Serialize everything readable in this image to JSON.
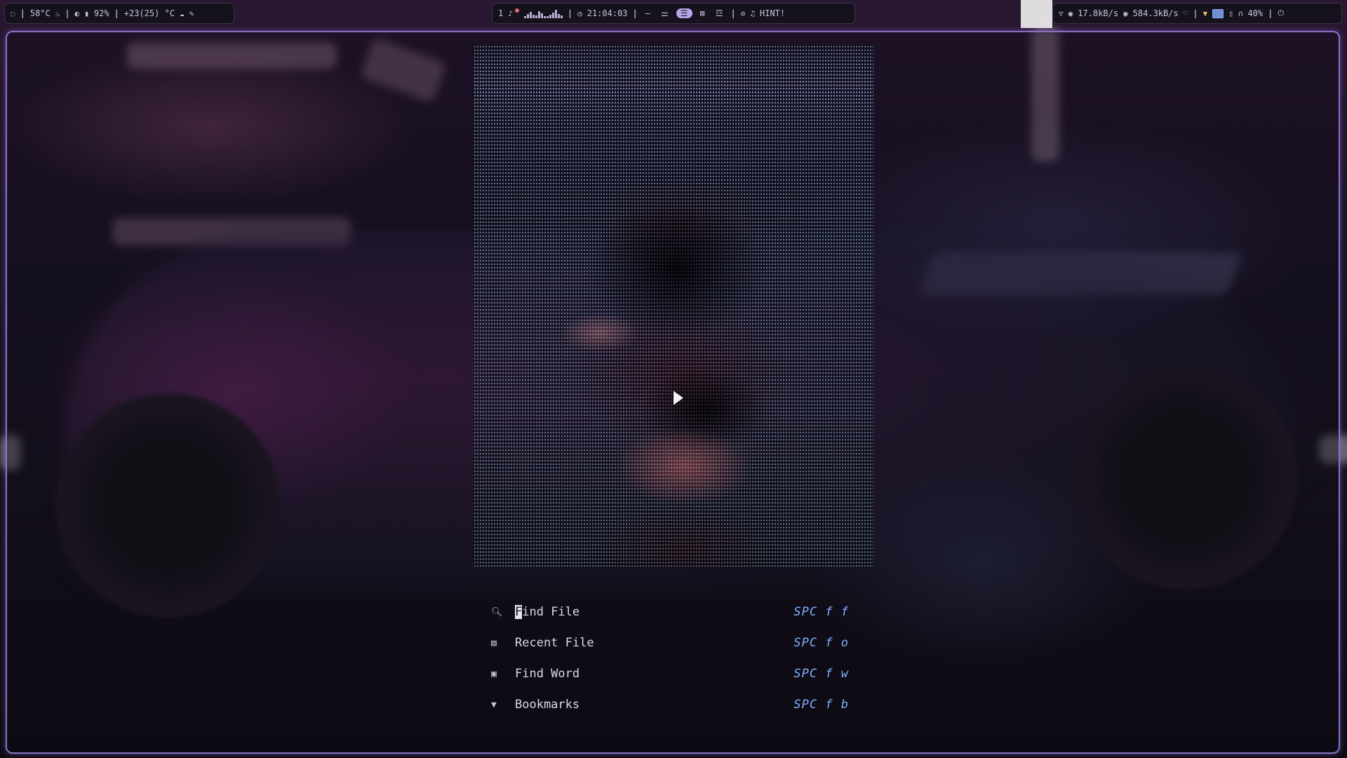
{
  "topbar": {
    "left": {
      "cpu_temp": "58°C",
      "brightness": "92%",
      "weather": "+23(25) °C"
    },
    "center": {
      "workspace": "1",
      "clock": "21:04:03",
      "hint": "HINT!"
    },
    "right": {
      "net_down": "17.8kB/s",
      "net_up": "584.3kB/s",
      "volume": "40%"
    }
  },
  "dashboard": {
    "items": [
      {
        "icon": "search-icon",
        "label": "Find File",
        "label_rest": "ind File",
        "label_first": "F",
        "key": "SPC f f"
      },
      {
        "icon": "file-icon",
        "label": "Recent File",
        "key": "SPC f o"
      },
      {
        "icon": "word-icon",
        "label": "Find Word",
        "key": "SPC f w"
      },
      {
        "icon": "bookmark-icon",
        "label": "Bookmarks",
        "key": "SPC f b"
      }
    ]
  },
  "colors": {
    "accent": "#8a72c8",
    "keybind": "#7fb0ff",
    "active_workspace": "#b9a6e8"
  }
}
